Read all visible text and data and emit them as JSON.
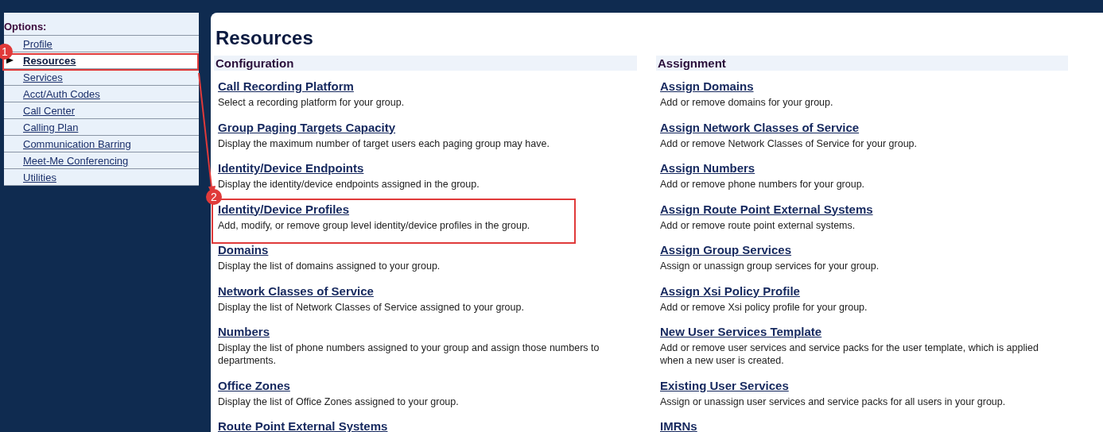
{
  "sidebar": {
    "heading": "Options:",
    "items": [
      {
        "label": "Profile",
        "selected": false
      },
      {
        "label": "Resources",
        "selected": true
      },
      {
        "label": "Services",
        "selected": false
      },
      {
        "label": "Acct/Auth Codes",
        "selected": false
      },
      {
        "label": "Call Center",
        "selected": false
      },
      {
        "label": "Calling Plan",
        "selected": false
      },
      {
        "label": "Communication Barring",
        "selected": false
      },
      {
        "label": "Meet-Me Conferencing",
        "selected": false
      },
      {
        "label": "Utilities",
        "selected": false
      }
    ]
  },
  "page_title": "Resources",
  "columns": [
    {
      "heading": "Configuration",
      "entries": [
        {
          "title": "Call Recording Platform",
          "description": "Select a recording platform for your group."
        },
        {
          "title": "Group Paging Targets Capacity",
          "description": "Display the maximum number of target users each paging group may have."
        },
        {
          "title": "Identity/Device Endpoints",
          "description": "Display the identity/device endpoints assigned in the group."
        },
        {
          "title": "Identity/Device Profiles",
          "description": "Add, modify, or remove group level identity/device profiles in the group."
        },
        {
          "title": "Domains",
          "description": "Display the list of domains assigned to your group."
        },
        {
          "title": "Network Classes of Service",
          "description": "Display the list of Network Classes of Service assigned to your group."
        },
        {
          "title": "Numbers",
          "description": "Display the list of phone numbers assigned to your group and assign those numbers to departments."
        },
        {
          "title": "Office Zones",
          "description": "Display the list of Office Zones assigned to your group."
        },
        {
          "title": "Route Point External Systems"
        }
      ]
    },
    {
      "heading": "Assignment",
      "entries": [
        {
          "title": "Assign Domains",
          "description": "Add or remove domains for your group."
        },
        {
          "title": "Assign Network Classes of Service",
          "description": "Add or remove Network Classes of Service for your group."
        },
        {
          "title": "Assign Numbers",
          "description": "Add or remove phone numbers for your group."
        },
        {
          "title": "Assign Route Point External Systems",
          "description": "Add or remove route point external systems."
        },
        {
          "title": "Assign Group Services",
          "description": "Assign or unassign group services for your group."
        },
        {
          "title": "Assign Xsi Policy Profile",
          "description": "Add or remove Xsi policy profile for your group."
        },
        {
          "title": "New User Services Template",
          "description": "Add or remove user services and service packs for the user template, which is applied when a new user is created."
        },
        {
          "title": "Existing User Services",
          "description": "Assign or unassign user services and service packs for all users in your group."
        },
        {
          "title": "IMRNs"
        }
      ]
    }
  ],
  "annotations": [
    {
      "label": "1"
    },
    {
      "label": "2"
    }
  ]
}
